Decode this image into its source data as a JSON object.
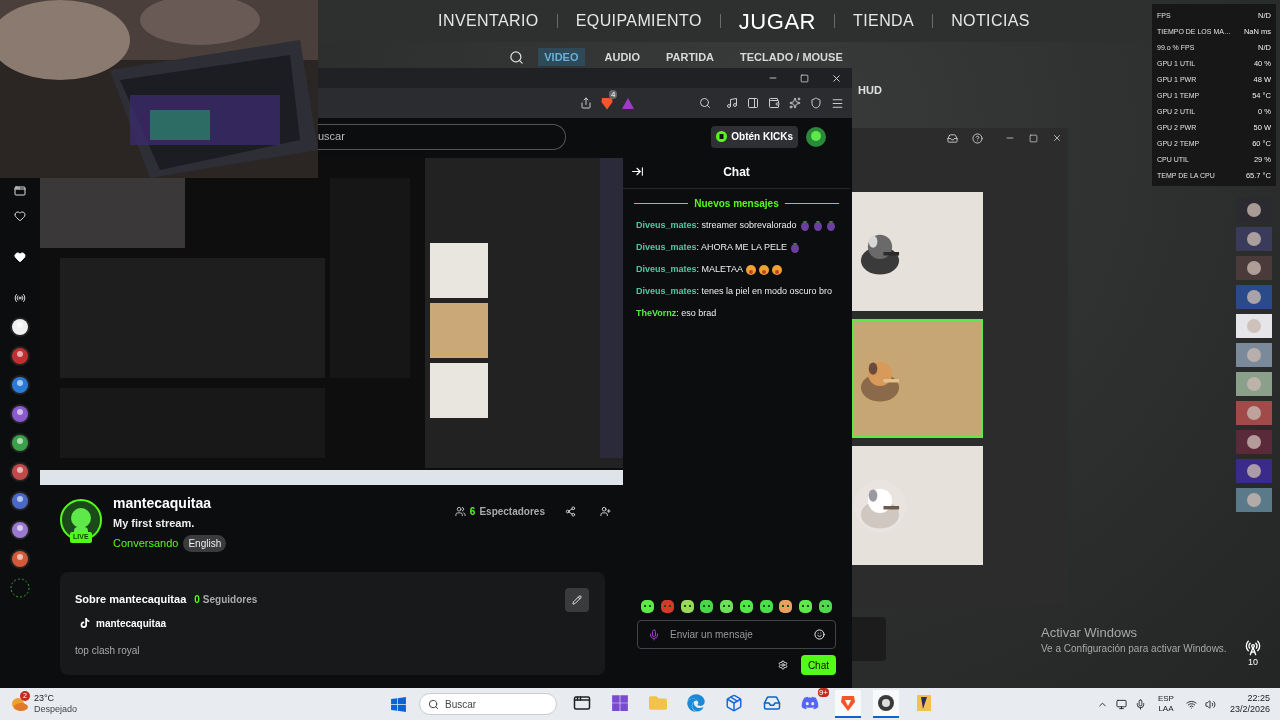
{
  "game": {
    "nav": [
      {
        "label": "INVENTARIO",
        "selected": false
      },
      {
        "label": "EQUIPAMIENTO",
        "selected": false
      },
      {
        "label": "JUGAR",
        "selected": true
      },
      {
        "label": "TIENDA",
        "selected": false
      },
      {
        "label": "NOTICIAS",
        "selected": false
      }
    ],
    "subtabs": [
      {
        "label": "VIDEO",
        "selected": true
      },
      {
        "label": "AUDIO",
        "selected": false
      },
      {
        "label": "PARTIDA",
        "selected": false
      },
      {
        "label": "TECLADO / MOUSE",
        "selected": false
      }
    ],
    "section_label": "HUD",
    "cards": [
      {
        "selected": false
      },
      {
        "selected": true
      },
      {
        "selected": false
      }
    ]
  },
  "stats_overlay": [
    {
      "label": "FPS",
      "value": "N/D"
    },
    {
      "label": "TIEMPO DE LOS MA…",
      "value": "NaN ms"
    },
    {
      "label": "99.o % FPS",
      "value": "N/D"
    },
    {
      "label": "GPU 1 UTIL",
      "value": "40 %"
    },
    {
      "label": "GPU 1 PWR",
      "value": "48 W"
    },
    {
      "label": "GPU 1 TEMP",
      "value": "54 °C"
    },
    {
      "label": "GPU 2 UTIL",
      "value": "0 %"
    },
    {
      "label": "GPU 2 PWR",
      "value": "50 W"
    },
    {
      "label": "GPU 2 TEMP",
      "value": "60 °C"
    },
    {
      "label": "CPU UTIL",
      "value": "29 %"
    },
    {
      "label": "TEMP DE LA CPU",
      "value": "65.7 °C"
    }
  ],
  "side_strip_badge": "10",
  "activation": {
    "title": "Activar Windows",
    "subtitle": "Ve a Configuración para activar Windows."
  },
  "browser": {
    "brave_badge": "4",
    "search_placeholder": "uscar",
    "kicks_button": "Obtén KICKs"
  },
  "stream": {
    "live_badge": "LIVE",
    "name": "mantecaquitaa",
    "title": "My first stream.",
    "category": "Conversando",
    "tag": "English",
    "viewer_count": "6",
    "viewer_label": "Espectadores",
    "about": {
      "heading": "Sobre mantecaquitaa",
      "followers": "0",
      "followers_label": "Seguidores",
      "tiktok": "mantecaquitaa",
      "bio": "top clash royal"
    }
  },
  "chat": {
    "title": "Chat",
    "divider": "Nuevos mensajes",
    "messages": [
      {
        "user": "Diveus_mates",
        "color": "#53c8a0",
        "text": ": streamer sobrevalorado",
        "emotes": [
          {
            "kind": "eggplant"
          },
          {
            "kind": "eggplant"
          },
          {
            "kind": "eggplant"
          }
        ]
      },
      {
        "user": "Diveus_mates",
        "color": "#53c8a0",
        "text": ": AHORA ME LA PELE",
        "emotes": [
          {
            "kind": "eggplant"
          }
        ]
      },
      {
        "user": "Diveus_mates",
        "color": "#53c8a0",
        "text": ": MALETAA",
        "emotes": [
          {
            "kind": "face"
          },
          {
            "kind": "face"
          },
          {
            "kind": "face"
          }
        ]
      },
      {
        "user": "Diveus_mates",
        "color": "#53c8a0",
        "text": ": tenes la piel en modo oscuro bro"
      },
      {
        "user": "TheVornz",
        "color": "#5ee84a",
        "text": ": eso brad"
      }
    ],
    "input_placeholder": "Enviar un mensaje",
    "send_button": "Chat"
  },
  "taskbar": {
    "weather_badge": "2",
    "temperature": "23°C",
    "condition": "Despejado",
    "search_placeholder": "Buscar",
    "apps": [
      {
        "kind": "taskview",
        "selected": false
      },
      {
        "kind": "m365",
        "selected": false
      },
      {
        "kind": "folder",
        "selected": false
      },
      {
        "kind": "edge",
        "selected": false
      },
      {
        "kind": "store",
        "selected": false
      },
      {
        "kind": "outlook",
        "selected": false
      },
      {
        "kind": "discord",
        "selected": false,
        "badge": "9+"
      },
      {
        "kind": "brave",
        "selected": true
      },
      {
        "kind": "obs",
        "selected": true
      },
      {
        "kind": "game",
        "selected": false
      }
    ],
    "language": "ESP",
    "layout": "LAA",
    "time": "22:25",
    "date": "23/2/2026"
  }
}
